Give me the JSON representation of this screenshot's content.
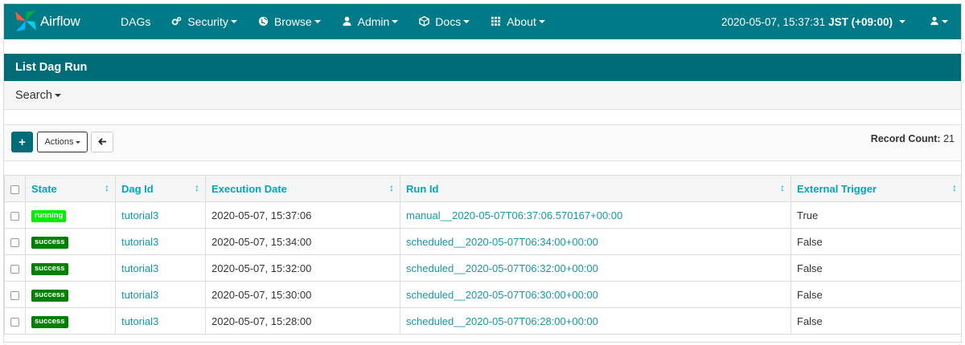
{
  "navbar": {
    "brand": "Airflow",
    "items": [
      {
        "label": "DAGs",
        "icon": "none",
        "dropdown": false
      },
      {
        "label": "Security",
        "icon": "cogs-icon",
        "dropdown": true
      },
      {
        "label": "Browse",
        "icon": "globe-icon",
        "dropdown": true
      },
      {
        "label": "Admin",
        "icon": "user-icon",
        "dropdown": true
      },
      {
        "label": "Docs",
        "icon": "cube-icon",
        "dropdown": true
      },
      {
        "label": "About",
        "icon": "grid-icon",
        "dropdown": true
      }
    ],
    "clock": "2020-05-07, 15:37:31",
    "timezone": "JST (+09:00)",
    "user_icon": "user-icon"
  },
  "panel": {
    "title": "List Dag Run",
    "search_label": "Search"
  },
  "toolbar": {
    "add_label": "+",
    "actions_label": "Actions",
    "back_icon": "arrow-left-icon",
    "record_count_label": "Record Count:",
    "record_count_value": "21"
  },
  "table": {
    "columns": [
      "State",
      "Dag Id",
      "Execution Date",
      "Run Id",
      "External Trigger"
    ],
    "rows": [
      {
        "state": "running",
        "dag_id": "tutorial3",
        "execution_date": "2020-05-07, 15:37:06",
        "run_id": "manual__2020-05-07T06:37:06.570167+00:00",
        "external_trigger": "True"
      },
      {
        "state": "success",
        "dag_id": "tutorial3",
        "execution_date": "2020-05-07, 15:34:00",
        "run_id": "scheduled__2020-05-07T06:34:00+00:00",
        "external_trigger": "False"
      },
      {
        "state": "success",
        "dag_id": "tutorial3",
        "execution_date": "2020-05-07, 15:32:00",
        "run_id": "scheduled__2020-05-07T06:32:00+00:00",
        "external_trigger": "False"
      },
      {
        "state": "success",
        "dag_id": "tutorial3",
        "execution_date": "2020-05-07, 15:30:00",
        "run_id": "scheduled__2020-05-07T06:30:00+00:00",
        "external_trigger": "False"
      },
      {
        "state": "success",
        "dag_id": "tutorial3",
        "execution_date": "2020-05-07, 15:28:00",
        "run_id": "scheduled__2020-05-07T06:28:00+00:00",
        "external_trigger": "False"
      }
    ]
  },
  "colors": {
    "navbar": "#007a87",
    "panel_header": "#006c78",
    "link": "#1497a8",
    "header_text": "#00a7bb",
    "state_running": "#00ee00",
    "state_success": "#008000"
  }
}
